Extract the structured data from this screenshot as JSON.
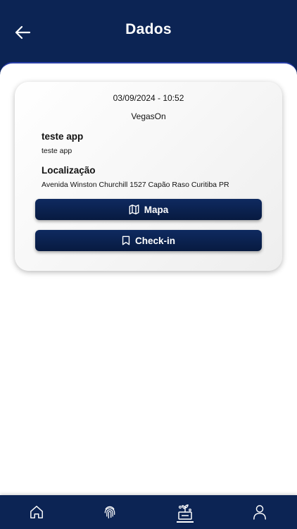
{
  "header": {
    "title": "Dados",
    "back_icon": "arrow-left-icon"
  },
  "card": {
    "datetime": "03/09/2024 - 10:52",
    "company": "VegasOn",
    "description_title": "teste app",
    "description_value": "teste app",
    "location_title": "Localização",
    "location_value": "Avenida Winston Churchill 1527 Capão Raso Curitiba PR"
  },
  "buttons": {
    "map_label": "Mapa",
    "map_icon": "map-icon",
    "checkin_label": "Check-in",
    "checkin_icon": "bookmark-icon"
  },
  "bottom_nav": {
    "items": [
      {
        "icon": "home-icon"
      },
      {
        "icon": "fingerprint-icon"
      },
      {
        "icon": "plant-icon",
        "active": true
      },
      {
        "icon": "user-icon"
      }
    ]
  },
  "colors": {
    "primary": "#0c2454",
    "button": "#0a1f4a",
    "background": "#ffffff"
  }
}
